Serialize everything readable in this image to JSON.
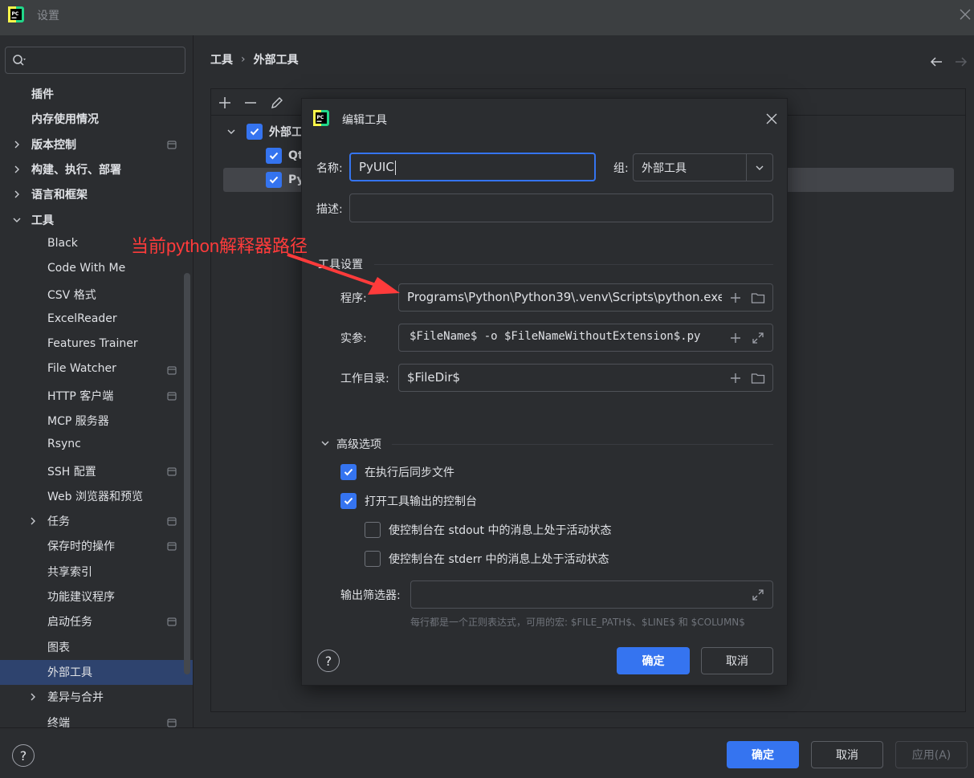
{
  "window": {
    "title": "设置"
  },
  "sidebar": {
    "search": {
      "placeholder": ""
    },
    "items": [
      {
        "label": "插件",
        "bold": true,
        "level": 1,
        "expander": false,
        "pin": false
      },
      {
        "label": "内存使用情况",
        "bold": true,
        "level": 1,
        "expander": false,
        "pin": false
      },
      {
        "label": "版本控制",
        "bold": true,
        "level": 1,
        "expander": "collapsed",
        "pin": true
      },
      {
        "label": "构建、执行、部署",
        "bold": true,
        "level": 1,
        "expander": "collapsed",
        "pin": false
      },
      {
        "label": "语言和框架",
        "bold": true,
        "level": 1,
        "expander": "collapsed",
        "pin": false
      },
      {
        "label": "工具",
        "bold": true,
        "level": 1,
        "expander": "expanded",
        "pin": false
      },
      {
        "label": "Black",
        "bold": false,
        "level": 2,
        "expander": false,
        "pin": false
      },
      {
        "label": "Code With Me",
        "bold": false,
        "level": 2,
        "expander": false,
        "pin": false
      },
      {
        "label": "CSV 格式",
        "bold": false,
        "level": 2,
        "expander": false,
        "pin": false
      },
      {
        "label": "ExcelReader",
        "bold": false,
        "level": 2,
        "expander": false,
        "pin": false
      },
      {
        "label": "Features Trainer",
        "bold": false,
        "level": 2,
        "expander": false,
        "pin": false
      },
      {
        "label": "File Watcher",
        "bold": false,
        "level": 2,
        "expander": false,
        "pin": true
      },
      {
        "label": "HTTP 客户端",
        "bold": false,
        "level": 2,
        "expander": false,
        "pin": true
      },
      {
        "label": "MCP 服务器",
        "bold": false,
        "level": 2,
        "expander": false,
        "pin": false
      },
      {
        "label": "Rsync",
        "bold": false,
        "level": 2,
        "expander": false,
        "pin": false
      },
      {
        "label": "SSH 配置",
        "bold": false,
        "level": 2,
        "expander": false,
        "pin": true
      },
      {
        "label": "Web 浏览器和预览",
        "bold": false,
        "level": 2,
        "expander": false,
        "pin": false
      },
      {
        "label": "任务",
        "bold": false,
        "level": 2,
        "expander": "collapsed",
        "pin": true
      },
      {
        "label": "保存时的操作",
        "bold": false,
        "level": 2,
        "expander": false,
        "pin": true
      },
      {
        "label": "共享索引",
        "bold": false,
        "level": 2,
        "expander": false,
        "pin": false
      },
      {
        "label": "功能建议程序",
        "bold": false,
        "level": 2,
        "expander": false,
        "pin": false
      },
      {
        "label": "启动任务",
        "bold": false,
        "level": 2,
        "expander": false,
        "pin": true
      },
      {
        "label": "图表",
        "bold": false,
        "level": 2,
        "expander": false,
        "pin": false
      },
      {
        "label": "外部工具",
        "bold": false,
        "level": 2,
        "expander": false,
        "pin": false,
        "selected": true
      },
      {
        "label": "差异与合并",
        "bold": false,
        "level": 2,
        "expander": "collapsed",
        "pin": false
      },
      {
        "label": "终端",
        "bold": false,
        "level": 2,
        "expander": false,
        "pin": true
      }
    ]
  },
  "breadcrumb": {
    "root": "工具",
    "separator": "›",
    "current": "外部工具"
  },
  "tree": {
    "group_label": "外部工",
    "items": [
      {
        "label": "Qt"
      },
      {
        "label": "Py"
      }
    ]
  },
  "dialog": {
    "title": "编辑工具",
    "name_label": "名称:",
    "name_value": "PyUIC",
    "group_label": "组:",
    "group_value": "外部工具",
    "desc_label": "描述:",
    "desc_value": "",
    "tool_settings": "工具设置",
    "program_label": "程序:",
    "program_value": "Programs\\Python\\Python39\\.venv\\Scripts\\python.exe",
    "args_label": "实参:",
    "args_value": "$FileName$ -o $FileNameWithoutExtension$.py",
    "workdir_label": "工作目录:",
    "workdir_value": "$FileDir$",
    "advanced": "高级选项",
    "sync_files": "在执行后同步文件",
    "open_console": "打开工具输出的控制台",
    "stdout_active": "使控制台在 stdout 中的消息上处于活动状态",
    "stderr_active": "使控制台在 stderr 中的消息上处于活动状态",
    "output_filter_label": "输出筛选器:",
    "output_filter_value": "",
    "hint": "每行都是一个正则表达式，可用的宏: $FILE_PATH$、$LINE$ 和 $COLUMN$",
    "ok": "确定",
    "cancel": "取消",
    "help": "?"
  },
  "annotation": {
    "text": "当前python解释器路径",
    "color": "#ff3b3b"
  },
  "footer": {
    "ok": "确定",
    "cancel": "取消",
    "apply": "应用(A)",
    "help": "?"
  },
  "colors": {
    "accent": "#3574f0",
    "selection": "#2e436e",
    "background": "#2b2d30"
  }
}
